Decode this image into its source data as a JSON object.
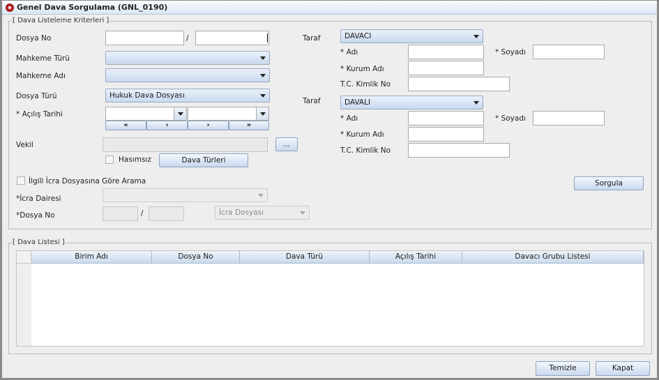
{
  "window": {
    "title": "Genel Dava Sorgulama (GNL_0190)"
  },
  "criteria": {
    "legend": "[ Dava Listeleme Kriterleri ]",
    "dosya_no_label": "Dosya No",
    "dosya_no_sep": "/",
    "mahkeme_turu_label": "Mahkeme Türü",
    "mahkeme_adi_label": "Mahkeme Adı",
    "dosya_turu_label": "Dosya Türü",
    "dosya_turu_value": "Hukuk Dava Dosyası",
    "acilis_tarihi_label": "* Açılış Tarihi",
    "nav": [
      "«",
      "‹",
      "›",
      "»"
    ],
    "vekil_label": "Vekil",
    "vekil_button": "...",
    "hasimsiz_label": "Hasımsız",
    "dava_turleri_button": "Dava Türleri",
    "icra_check_label": "İlgili İcra Dosyasına Göre Arama",
    "icra_dairesi_label": "*İcra Dairesi",
    "icra_dosya_no_label": "*Dosya No",
    "icra_dosya_sep": "/",
    "icra_dosyasi_value": "İcra Dosyası",
    "taraf_label": "Taraf",
    "taraf1_value": "DAVACI",
    "taraf2_value": "DAVALI",
    "adi_label": "* Adı",
    "soyadi_label": "* Soyadı",
    "kurum_adi_label": "* Kurum Adı",
    "tc_label": "T.C. Kimlik No",
    "sorgula_button": "Sorgula"
  },
  "list": {
    "legend": "[ Dava Listesi ]",
    "columns": [
      "Birim Adı",
      "Dosya No",
      "Dava Türü",
      "Açılış Tarihi",
      "Davacı Grubu Listesi"
    ]
  },
  "footer": {
    "temizle_button": "Temizle",
    "kapat_button": "Kapat"
  }
}
